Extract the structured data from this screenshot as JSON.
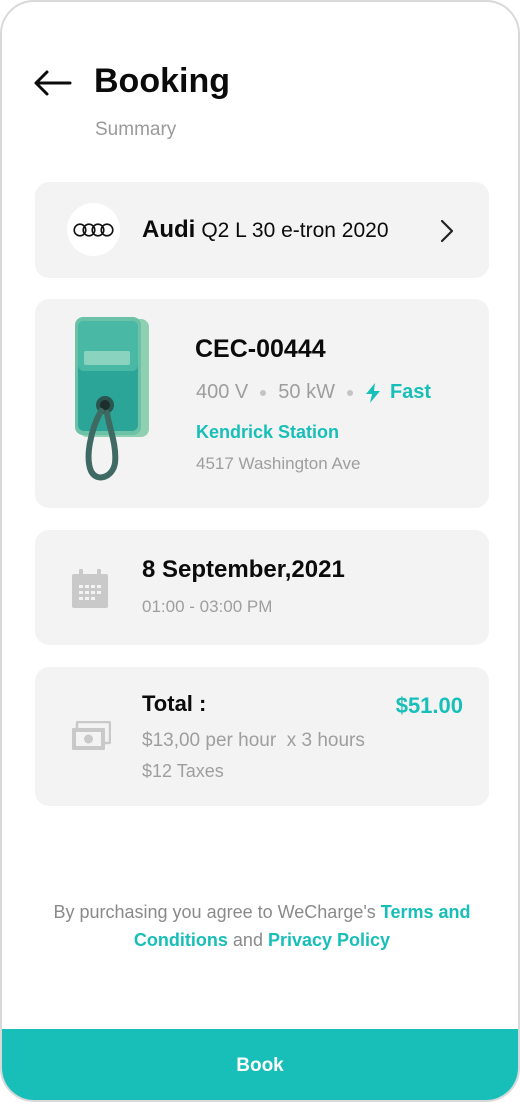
{
  "header": {
    "title": "Booking",
    "subtitle": "Summary",
    "back_icon": "arrow-left-icon"
  },
  "vehicle": {
    "brand": "Audi",
    "model": "Q2 L 30 e-tron 2020",
    "logo_icon": "audi-rings-icon",
    "chevron_icon": "chevron-right-icon"
  },
  "station": {
    "code": "CEC-00444",
    "voltage": "400 V",
    "power": "50 kW",
    "speed": "Fast",
    "name": "Kendrick Station",
    "address": "4517 Washington Ave",
    "image_icon": "ev-charger-icon"
  },
  "schedule": {
    "date": "8 September,2021",
    "time": "01:00 - 03:00 PM",
    "icon": "calendar-icon"
  },
  "payment": {
    "total_label": "Total :",
    "total_value": "$51.00",
    "rate": "$13,00 per hour  x 3 hours",
    "taxes": "$12 Taxes",
    "icon": "cash-icon"
  },
  "terms": {
    "prefix": "By purchasing you agree to WeCharge's",
    "terms_link": "Terms and Conditions",
    "conjunction": "and",
    "privacy_link": "Privacy Policy"
  },
  "actions": {
    "book_label": "Book"
  },
  "colors": {
    "accent": "#17bfb8",
    "card_bg": "#f3f3f3",
    "muted_text": "#9e9e9e"
  }
}
